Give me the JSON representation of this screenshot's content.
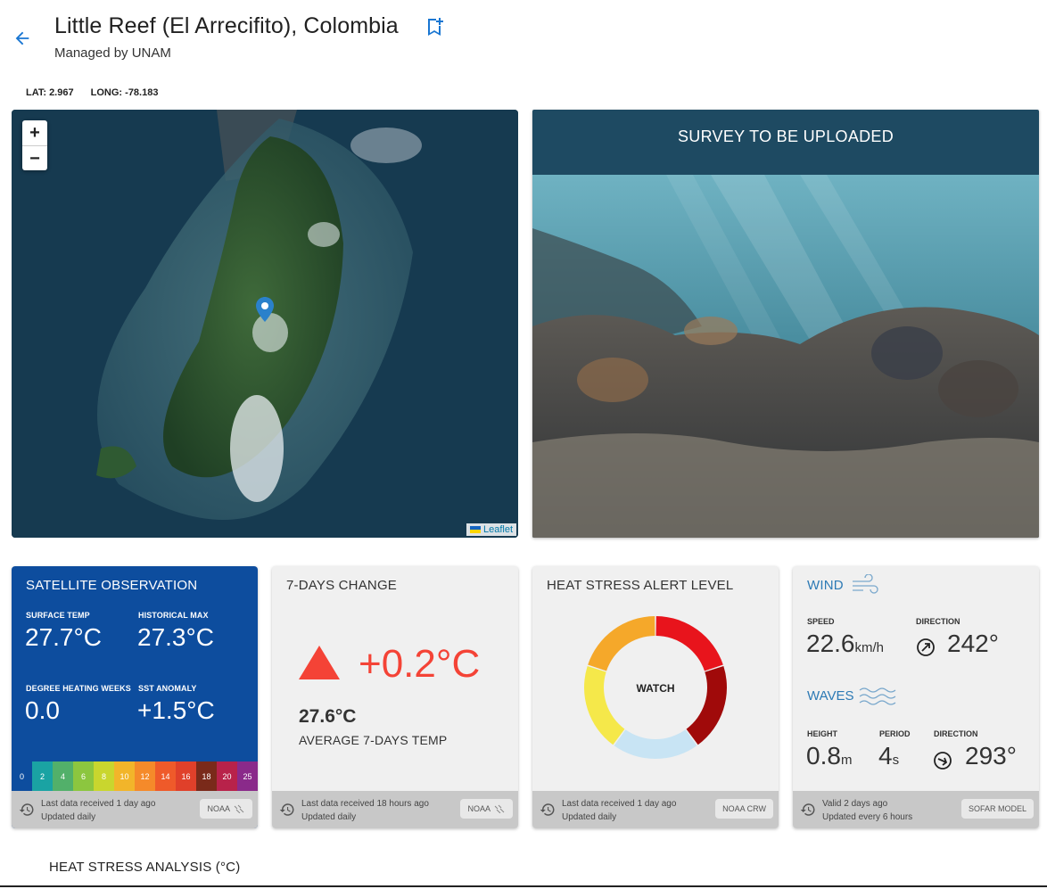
{
  "header": {
    "title": "Little Reef (El Arrecifito), Colombia",
    "subtitle": "Managed by UNAM",
    "lat_label": "LAT: 2.967",
    "long_label": "LONG: -78.183"
  },
  "map": {
    "zoom_in": "+",
    "zoom_out": "−",
    "attribution": "Leaflet"
  },
  "survey": {
    "banner": "SURVEY TO BE UPLOADED"
  },
  "satellite": {
    "title": "SATELLITE OBSERVATION",
    "surface_temp_label": "SURFACE TEMP",
    "surface_temp_value": "27.7°C",
    "historical_max_label": "HISTORICAL MAX",
    "historical_max_value": "27.3°C",
    "dhw_label": "DEGREE HEATING WEEKS",
    "dhw_value": "0.0",
    "sst_anomaly_label": "SST ANOMALY",
    "sst_anomaly_value": "+1.5°C",
    "scale": [
      {
        "label": "0",
        "color": "#0d4d9e"
      },
      {
        "label": "2",
        "color": "#1aa3a3"
      },
      {
        "label": "4",
        "color": "#52b06a"
      },
      {
        "label": "6",
        "color": "#8cc63f"
      },
      {
        "label": "8",
        "color": "#c9d62e"
      },
      {
        "label": "10",
        "color": "#f2b52a"
      },
      {
        "label": "12",
        "color": "#f58a2a"
      },
      {
        "label": "14",
        "color": "#ef5a2a"
      },
      {
        "label": "16",
        "color": "#e0402a"
      },
      {
        "label": "18",
        "color": "#7a2a1a"
      },
      {
        "label": "20",
        "color": "#b8224a"
      },
      {
        "label": "25",
        "color": "#8a2a8a"
      }
    ],
    "footer_line1": "Last data received 1 day ago",
    "footer_line2": "Updated daily",
    "badge": "NOAA"
  },
  "change": {
    "title": "7-DAYS CHANGE",
    "value": "+0.2°C",
    "avg_temp": "27.6°C",
    "avg_label": "AVERAGE 7-DAYS TEMP",
    "footer_line1": "Last data received 18 hours ago",
    "footer_line2": "Updated daily",
    "badge": "NOAA"
  },
  "heat_stress": {
    "title": "HEAT STRESS ALERT LEVEL",
    "level": "WATCH",
    "segments": [
      {
        "color": "#e8141c"
      },
      {
        "color": "#a00a0a"
      },
      {
        "color": "#c8e4f4"
      },
      {
        "color": "#f5e84a"
      },
      {
        "color": "#f5a82a"
      }
    ],
    "footer_line1": "Last data received 1 day ago",
    "footer_line2": "Updated daily",
    "badge": "NOAA CRW"
  },
  "wind": {
    "title": "WIND",
    "speed_label": "SPEED",
    "speed_value": "22.6",
    "speed_unit": "km/h",
    "direction_label": "DIRECTION",
    "direction_value": "242°",
    "waves_title": "WAVES",
    "height_label": "HEIGHT",
    "height_value": "0.8",
    "height_unit": "m",
    "period_label": "PERIOD",
    "period_value": "4",
    "period_unit": "s",
    "wave_direction_label": "DIRECTION",
    "wave_direction_value": "293°",
    "footer_line1": "Valid 2 days ago",
    "footer_line2": "Updated every 6 hours",
    "badge": "SOFAR MODEL"
  },
  "analysis": {
    "title": "HEAT STRESS ANALYSIS (°C)"
  },
  "colors": {
    "satellite_bg": "#0d4d9e",
    "accent_blue": "#2d7ab5",
    "change_red": "#f44336",
    "survey_banner": "#1e4a62"
  }
}
